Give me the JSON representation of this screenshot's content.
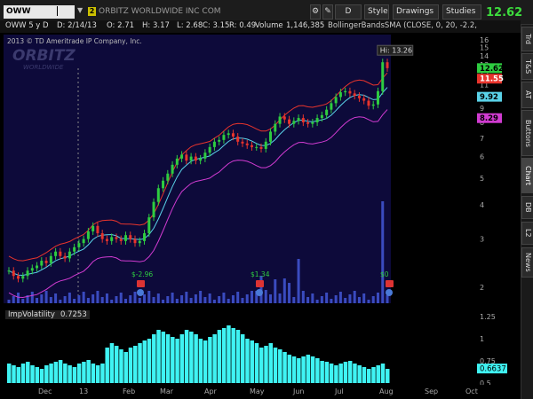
{
  "header": {
    "symbol": "OWW",
    "badge": "2",
    "company": "ORBITZ WORLDWIDE INC COM",
    "buttons": {
      "period": "D",
      "style": "Style",
      "drawings": "Drawings",
      "studies": "Studies"
    },
    "last_price": "12.62"
  },
  "info": {
    "label": "OWW 5 y D",
    "date": "D: 2/14/13",
    "open": "O: 2.71",
    "high": "H: 3.17",
    "low": "L: 2.68",
    "close": "C: 3.15",
    "range": "R: 0.49",
    "volume_label": "Volume",
    "volume": "1,146,385",
    "study": "BollingerBandsSMA (CLOSE, 0, 20, -2.2,"
  },
  "chart_meta": {
    "copyright": "2013 © TD Ameritrade IP Company, Inc.",
    "watermark_name": "ORBITZ",
    "watermark_sub": "WORLDWIDE",
    "hi_label": "Hi: 13.26",
    "price_badges": {
      "last": "12.62",
      "upper": "11.55",
      "mid": "9.92",
      "lower": "8.29"
    },
    "earnings": [
      {
        "label": "$-2.96",
        "icon": "earnings-calendar-icon"
      },
      {
        "label": "$1.34",
        "icon": "earnings-calendar-icon"
      },
      {
        "label": "$0",
        "icon": "earnings-calendar-icon"
      }
    ],
    "colors": {
      "up": "#2ecc40",
      "down": "#e8342c",
      "upper_band": "#e8342c",
      "mid_band": "#5ad2e8",
      "lower_band": "#d13bd1",
      "volume": "#3a4bbf",
      "iv": "#3ff3f3",
      "bg": "#0d0a3a"
    }
  },
  "iv_panel": {
    "label": "ImpVolatility",
    "value": "0.7253",
    "last": "0.6637",
    "ticks": [
      "1.25",
      "1",
      "0.75",
      "0.5"
    ]
  },
  "chart_data": {
    "type": "line",
    "x_tick_labels": [
      "Dec",
      "13",
      "Feb",
      "Mar",
      "Apr",
      "May",
      "Jun",
      "Jul",
      "Aug",
      "Sep",
      "Oct"
    ],
    "y_tick_labels": [
      "16",
      "15",
      "14",
      "13",
      "12",
      "11",
      "10",
      "9",
      "8",
      "7",
      "6",
      "5",
      "4",
      "3",
      "2"
    ],
    "ylim": [
      2,
      16
    ],
    "y_scale": "log",
    "series": [
      {
        "name": "close",
        "values": [
          2.3,
          2.2,
          2.15,
          2.2,
          2.3,
          2.35,
          2.4,
          2.5,
          2.45,
          2.6,
          2.7,
          2.6,
          2.55,
          2.7,
          2.8,
          2.9,
          3.0,
          3.2,
          3.35,
          3.15,
          3.0,
          2.95,
          3.05,
          3.0,
          2.95,
          3.1,
          3.0,
          2.9,
          2.95,
          3.15,
          3.6,
          4.1,
          4.6,
          4.9,
          5.2,
          5.6,
          5.9,
          6.1,
          5.8,
          6.0,
          5.8,
          5.9,
          6.2,
          6.5,
          6.8,
          6.9,
          7.2,
          7.3,
          7.1,
          6.8,
          6.7,
          6.6,
          6.5,
          6.5,
          6.4,
          6.8,
          7.4,
          7.9,
          8.4,
          8.2,
          7.9,
          8.1,
          8.3,
          8.0,
          7.9,
          8.0,
          8.3,
          8.5,
          8.9,
          9.4,
          9.9,
          10.3,
          10.4,
          10.2,
          10.0,
          9.8,
          9.6,
          9.2,
          9.3,
          10.4,
          13.26,
          12.62
        ]
      }
    ],
    "volume_note": "volume bars shown at bottom",
    "iv_values": [
      0.72,
      0.7,
      0.68,
      0.72,
      0.74,
      0.7,
      0.68,
      0.66,
      0.7,
      0.72,
      0.74,
      0.76,
      0.72,
      0.7,
      0.68,
      0.72,
      0.74,
      0.76,
      0.72,
      0.7,
      0.72,
      0.9,
      0.95,
      0.92,
      0.88,
      0.85,
      0.9,
      0.92,
      0.95,
      0.98,
      1.0,
      1.05,
      1.1,
      1.08,
      1.05,
      1.02,
      1.0,
      1.05,
      1.1,
      1.08,
      1.05,
      1.0,
      0.98,
      1.02,
      1.05,
      1.1,
      1.12,
      1.15,
      1.12,
      1.1,
      1.05,
      1.0,
      0.98,
      0.95,
      0.9,
      0.92,
      0.95,
      0.9,
      0.88,
      0.85,
      0.82,
      0.8,
      0.78,
      0.8,
      0.82,
      0.8,
      0.78,
      0.75,
      0.74,
      0.72,
      0.7,
      0.72,
      0.74,
      0.75,
      0.72,
      0.7,
      0.68,
      0.66,
      0.68,
      0.7,
      0.72,
      0.66
    ],
    "iv_ylim": [
      0.5,
      1.3
    ]
  }
}
